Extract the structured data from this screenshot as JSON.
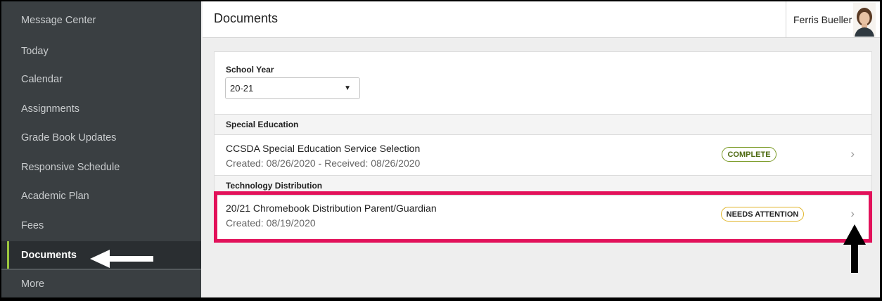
{
  "sidebar": {
    "items": [
      {
        "label": "Message Center"
      },
      {
        "label": "Today"
      },
      {
        "label": "Calendar"
      },
      {
        "label": "Assignments"
      },
      {
        "label": "Grade Book Updates"
      },
      {
        "label": "Responsive Schedule"
      },
      {
        "label": "Academic Plan"
      },
      {
        "label": "Fees"
      },
      {
        "label": "Documents",
        "active": true
      },
      {
        "label": "More"
      }
    ]
  },
  "header": {
    "title": "Documents",
    "user_name": "Ferris Bueller"
  },
  "filter": {
    "label": "School Year",
    "selected": "20-21"
  },
  "sections": [
    {
      "title": "Special Education",
      "documents": [
        {
          "title": "CCSDA Special Education Service Selection",
          "subtitle": "Created: 08/26/2020 - Received: 08/26/2020",
          "status": "COMPLETE"
        }
      ]
    },
    {
      "title": "Technology Distribution",
      "documents": [
        {
          "title": "20/21 Chromebook Distribution Parent/Guardian",
          "subtitle": "Created: 08/19/2020",
          "status": "NEEDS ATTENTION"
        }
      ]
    }
  ],
  "colors": {
    "sidebar_bg": "#3a3f42",
    "active_accent": "#9bc53d",
    "complete": "#7a9a25",
    "attention": "#e0b52a",
    "highlight": "#e2115a"
  }
}
